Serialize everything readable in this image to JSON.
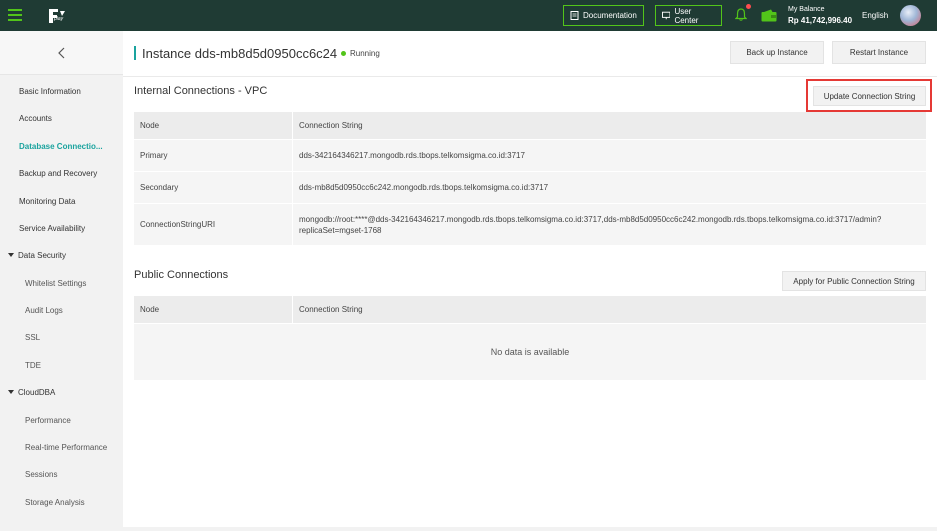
{
  "topbar": {
    "logo_text": "play",
    "documentation_label": "Documentation",
    "user_center_label": "User Center",
    "balance_label": "My Balance",
    "balance_value": "Rp 41,742,996.40",
    "language": "English"
  },
  "sidebar": {
    "items": [
      {
        "label": "Basic Information"
      },
      {
        "label": "Accounts"
      },
      {
        "label": "Database Connectio..."
      },
      {
        "label": "Backup and Recovery"
      },
      {
        "label": "Monitoring Data"
      },
      {
        "label": "Service Availability"
      },
      {
        "label": "Data Security"
      },
      {
        "label": "Whitelist Settings"
      },
      {
        "label": "Audit Logs"
      },
      {
        "label": "SSL"
      },
      {
        "label": "TDE"
      },
      {
        "label": "CloudDBA"
      },
      {
        "label": "Performance"
      },
      {
        "label": "Real-time Performance"
      },
      {
        "label": "Sessions"
      },
      {
        "label": "Storage Analysis"
      }
    ]
  },
  "header": {
    "title": "Instance dds-mb8d5d0950cc6c24",
    "status": "Running",
    "backup_label": "Back up Instance",
    "restart_label": "Restart Instance"
  },
  "internal": {
    "title": "Internal Connections - VPC",
    "update_label": "Update Connection String",
    "col_node": "Node",
    "col_conn": "Connection String",
    "rows": [
      {
        "node": "Primary",
        "conn": "dds-342164346217.mongodb.rds.tbops.telkomsigma.co.id:3717"
      },
      {
        "node": "Secondary",
        "conn": "dds-mb8d5d0950cc6c242.mongodb.rds.tbops.telkomsigma.co.id:3717"
      },
      {
        "node": "ConnectionStringURI",
        "conn": "mongodb://root:****@dds-342164346217.mongodb.rds.tbops.telkomsigma.co.id:3717,dds-mb8d5d0950cc6c242.mongodb.rds.tbops.telkomsigma.co.id:3717/admin?replicaSet=mgset-1768"
      }
    ]
  },
  "public": {
    "title": "Public Connections",
    "apply_label": "Apply for Public Connection String",
    "col_node": "Node",
    "col_conn": "Connection String",
    "empty": "No data is available"
  },
  "colors": {
    "accent": "#1aa39e",
    "topbar": "#1f3b34",
    "highlight": "#e53935"
  }
}
